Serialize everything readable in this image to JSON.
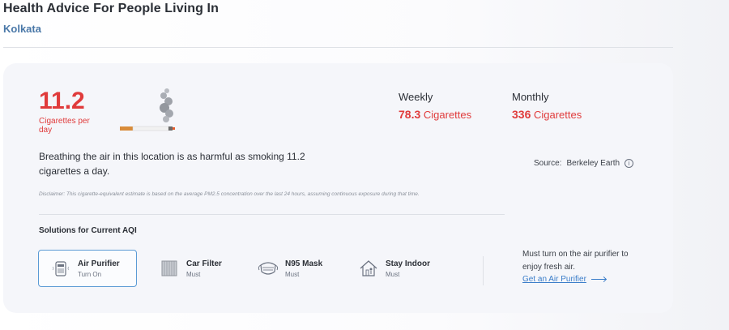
{
  "header": {
    "title": "Health Advice For People Living In",
    "city": "Kolkata"
  },
  "cigarettes": {
    "daily_value": "11.2",
    "daily_unit": "Cigarettes per day",
    "weekly": {
      "label": "Weekly",
      "value": "78.3",
      "unit": "Cigarettes"
    },
    "monthly": {
      "label": "Monthly",
      "value": "336",
      "unit": "Cigarettes"
    },
    "harm_text": "Breathing the air in this location is as harmful as smoking 11.2 cigarettes a day.",
    "source_label": "Source:",
    "source_name": "Berkeley Earth",
    "info_glyph": "i",
    "disclaimer": "Disclaimer: This cigarette-equivalent estimate is based on the average PM2.5 concentration over the last 24 hours, assuming continuous exposure during that time."
  },
  "solutions": {
    "title": "Solutions for Current AQI",
    "items": [
      {
        "name": "Air Purifier",
        "status": "Turn On",
        "icon": "air-purifier-icon",
        "active": true
      },
      {
        "name": "Car Filter",
        "status": "Must",
        "icon": "car-filter-icon",
        "active": false
      },
      {
        "name": "N95 Mask",
        "status": "Must",
        "icon": "mask-icon",
        "active": false
      },
      {
        "name": "Stay Indoor",
        "status": "Must",
        "icon": "house-icon",
        "active": false
      }
    ],
    "note": "Must turn on the air purifier to enjoy fresh air.",
    "link_label": "Get an Air Purifier"
  },
  "colors": {
    "accent_red": "#e03b3b",
    "link_blue": "#3a7dc9",
    "city_blue": "#4a78a8",
    "active_border": "#5b9bd5"
  }
}
